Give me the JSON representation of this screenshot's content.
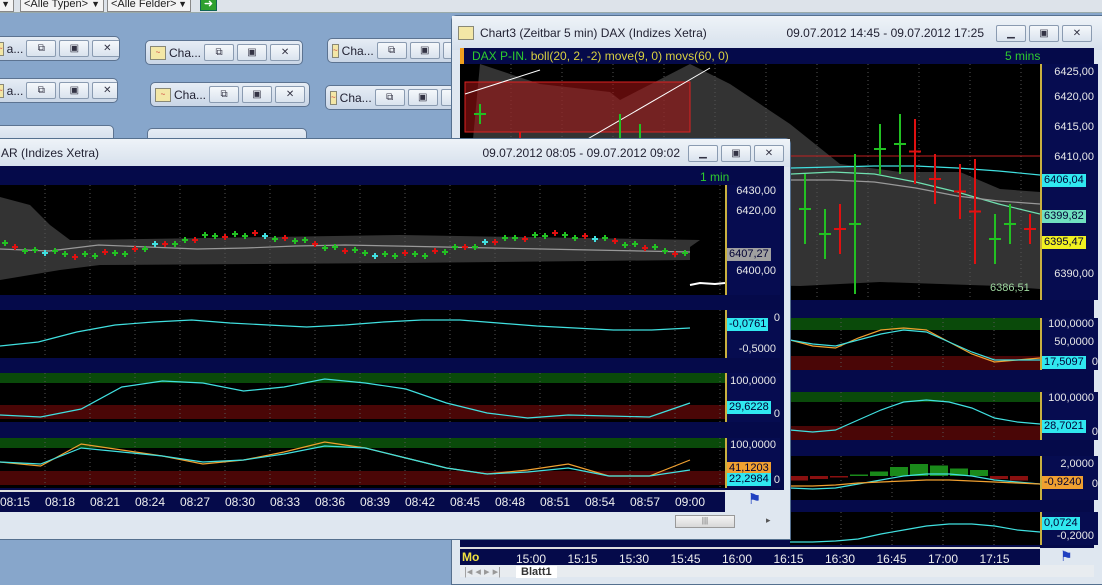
{
  "toolbar": {
    "type_filter": "<Alle Typen>",
    "field_filter": "<Alle Felder>",
    "go_icon": "arrow-right-icon"
  },
  "minimized": [
    "a...",
    "Cha...",
    "Cha...",
    "a...",
    "Cha...",
    "Cha..."
  ],
  "chart3": {
    "title": "Chart3 (Zeitbar 5 min)  DAX (Indizes Xetra)",
    "range": "09.07.2012 14:45 - 09.07.2012 17:25",
    "legend": "DAX P-IN.",
    "indicators": "boll(20, 2, -2) move(9, 0) movs(60, 0)",
    "interval": "5 mins",
    "price_labels": [
      "6425,00",
      "6420,00",
      "6415,00",
      "6410,00",
      "6390,00"
    ],
    "tags": {
      "upper": "6406,04",
      "mid": "6399,82",
      "last": "6395,47",
      "low": "6386,51"
    },
    "osc1": {
      "top": "100,0000",
      "mid": "50,0000",
      "value": "17,5097",
      "zero": "0"
    },
    "osc2": {
      "top": "100,0000",
      "value": "28,7021",
      "zero": "0"
    },
    "macd": {
      "top": "2,0000",
      "value": "-0,9240",
      "zero": "0"
    },
    "mom": {
      "value": "0,0724",
      "bottom": "-0,2000"
    },
    "day": "Mo",
    "times": [
      "15:00",
      "15:15",
      "15:30",
      "15:45",
      "16:00",
      "16:15",
      "16:30",
      "16:45",
      "17:00",
      "17:15"
    ],
    "sheet_tab": "Blatt1"
  },
  "chart_front": {
    "title": "AR (Indizes Xetra)",
    "range": "09.07.2012 08:05 - 09.07.2012 09:02",
    "interval": "1 min",
    "price_labels": [
      "6430,00",
      "6420,00",
      "6400,00"
    ],
    "last": "6407,27",
    "osc1": {
      "zero": "0",
      "value": "-0,0761",
      "bottom": "-0,5000"
    },
    "osc2": {
      "top": "100,0000",
      "value": "29,6228",
      "zero": "0"
    },
    "osc3": {
      "top": "100,0000",
      "value_a": "41,1203",
      "value_b": "22,2984",
      "zero": "0"
    },
    "times": [
      "08:15",
      "08:18",
      "08:21",
      "08:24",
      "08:27",
      "08:30",
      "08:33",
      "08:36",
      "08:39",
      "08:42",
      "08:45",
      "08:48",
      "08:51",
      "08:54",
      "08:57",
      "09:00"
    ]
  },
  "colors": {
    "up": "#22c022",
    "down": "#e01010",
    "cyan": "#40e0e0",
    "orange": "#f0a030"
  }
}
